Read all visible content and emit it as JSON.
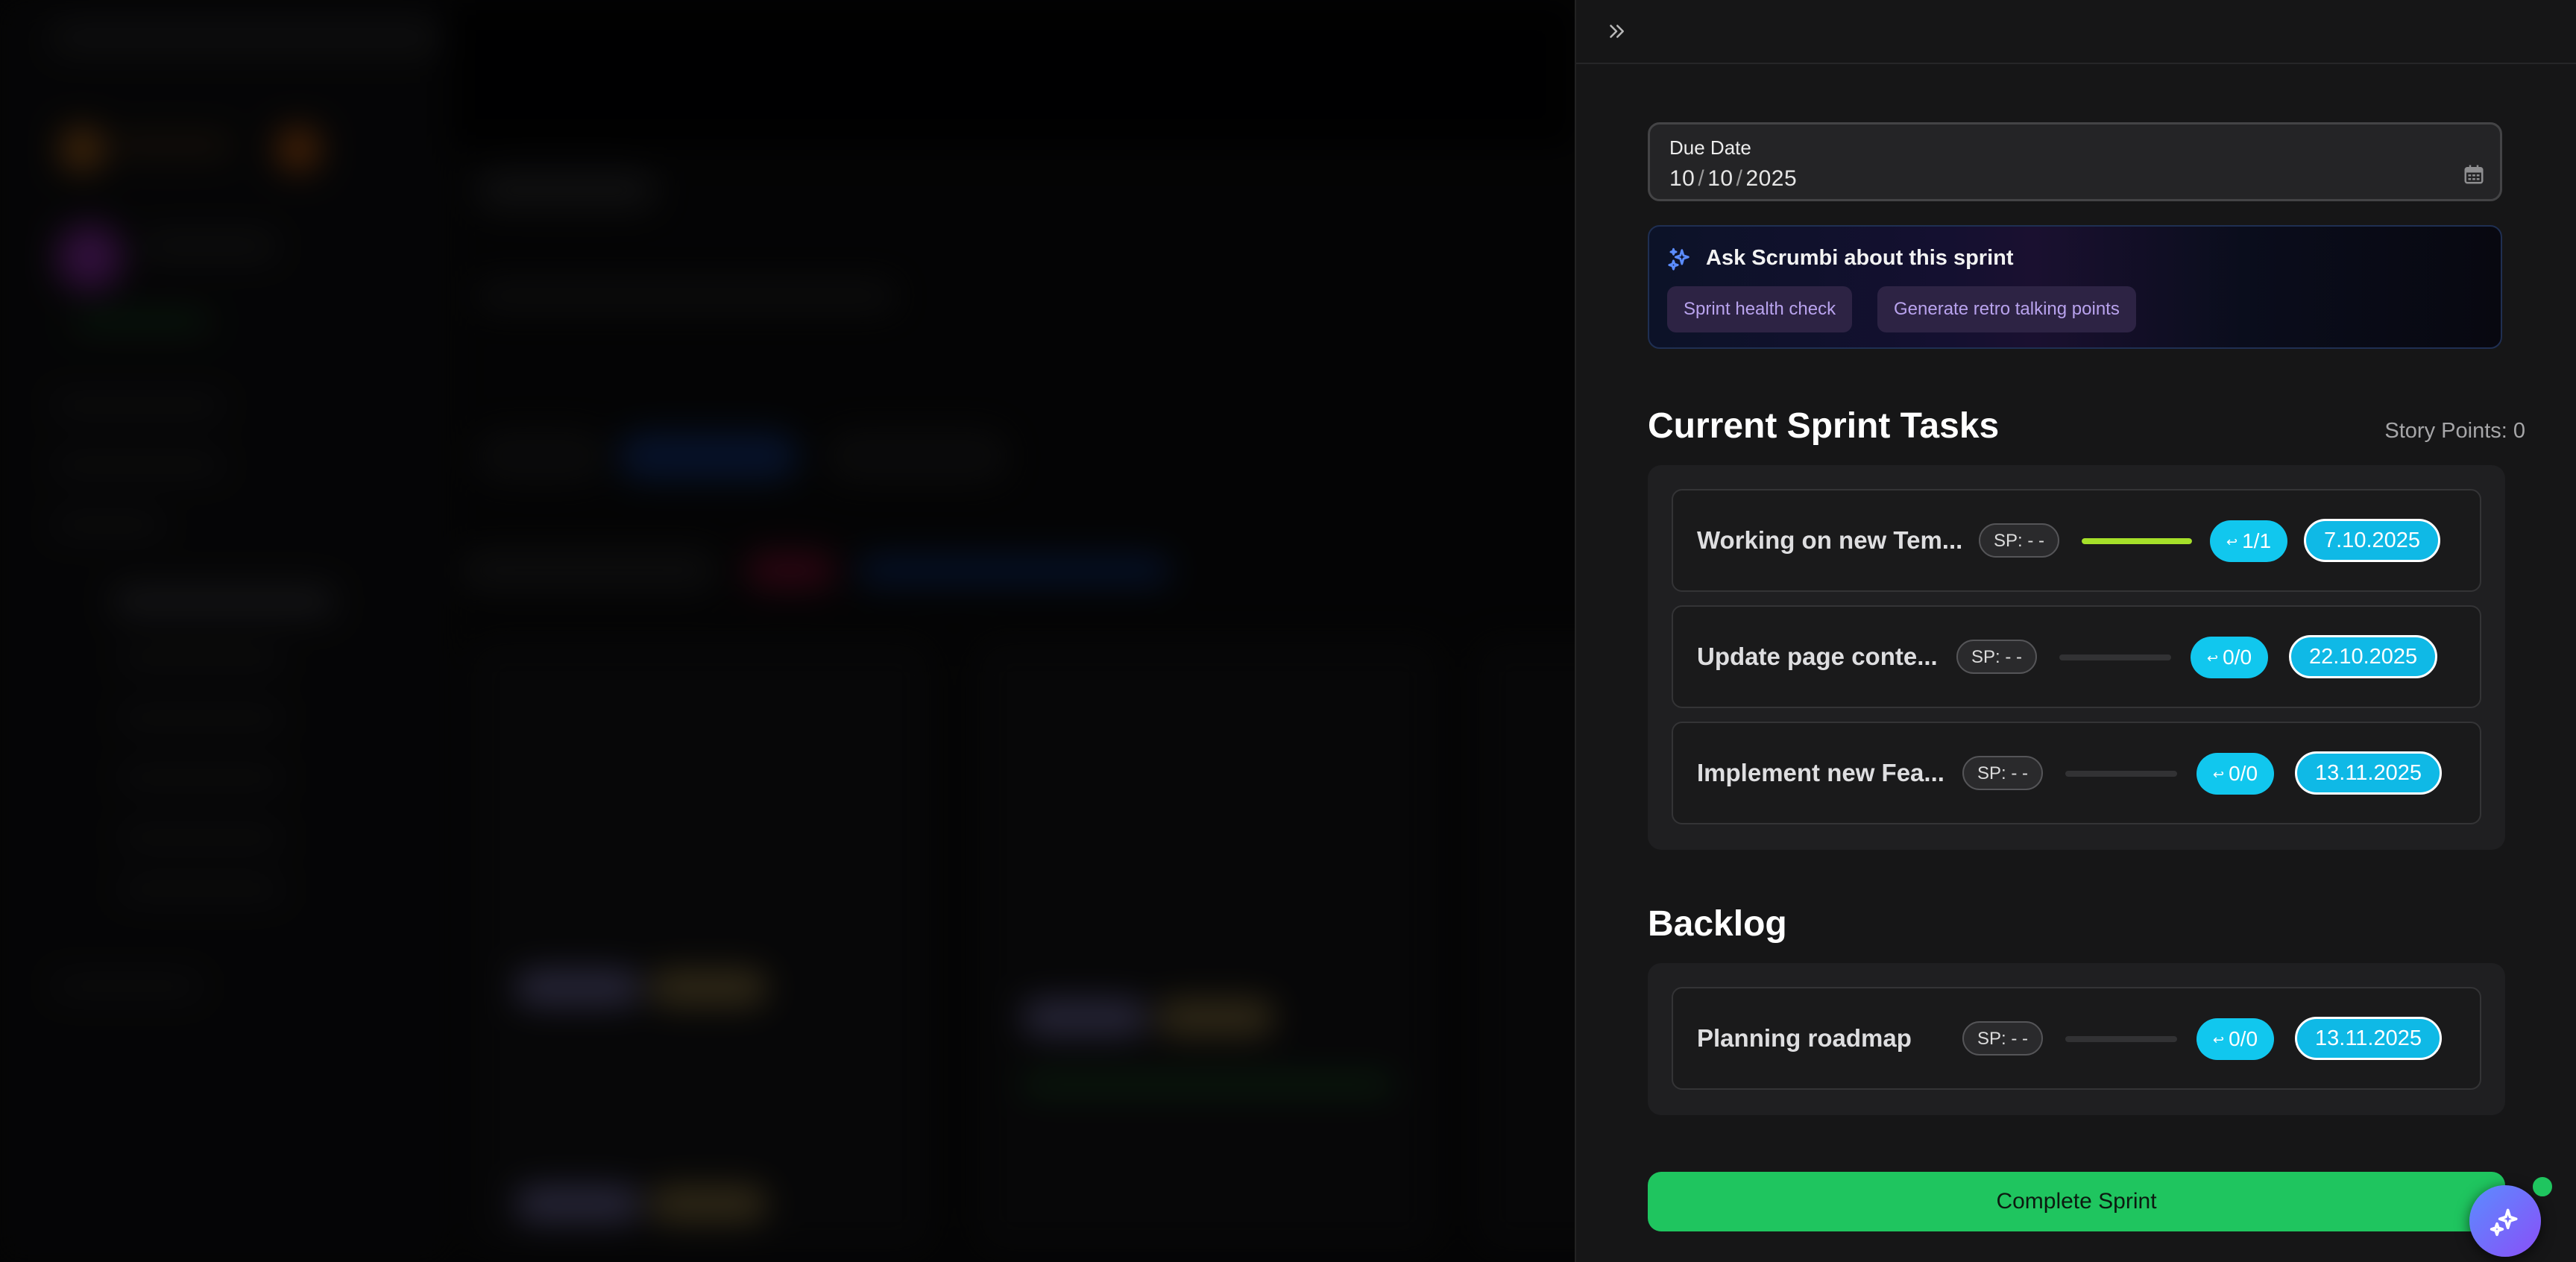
{
  "panel": {
    "due_date": {
      "label": "Due Date",
      "month": "10",
      "day": "10",
      "year": "2025",
      "separator": "/"
    },
    "ask": {
      "title": "Ask Scrumbi about this sprint",
      "chips": [
        "Sprint health check",
        "Generate retro talking points"
      ]
    },
    "current": {
      "title": "Current Sprint Tasks",
      "story_points": "Story Points: 0",
      "tasks": [
        {
          "name": "Working on new Tem...",
          "sp": "SP: - -",
          "subtasks": "1/1",
          "progress": 1.0,
          "date": "7.10.2025"
        },
        {
          "name": "Update page conte...",
          "sp": "SP: - -",
          "subtasks": "0/0",
          "progress": 0.0,
          "date": "22.10.2025"
        },
        {
          "name": "Implement new Fea...",
          "sp": "SP: - -",
          "subtasks": "0/0",
          "progress": 0.0,
          "date": "13.11.2025"
        }
      ]
    },
    "backlog": {
      "title": "Backlog",
      "tasks": [
        {
          "name": "Planning roadmap",
          "sp": "SP: - -",
          "subtasks": "0/0",
          "progress": 0.0,
          "date": "13.11.2025"
        }
      ]
    },
    "complete_label": "Complete Sprint"
  },
  "colors": {
    "accent_cyan": "#11c7ee",
    "progress_green": "#a6e02a",
    "complete_green": "#1fc55f",
    "chip_purple": "#2d2344"
  },
  "icons": [
    "chevrons-right-icon",
    "calendar-icon",
    "sparkles-icon",
    "subtask-hook-icon",
    "ai-assistant-icon"
  ]
}
